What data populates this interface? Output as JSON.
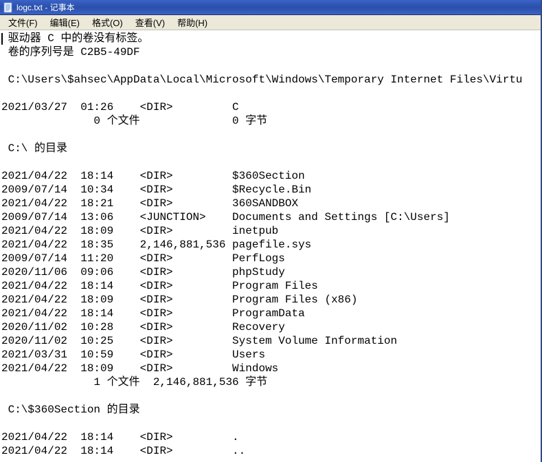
{
  "window": {
    "title": "logc.txt - 记事本"
  },
  "menu": {
    "file": "文件(F)",
    "edit": "编辑(E)",
    "format": "格式(O)",
    "view": "查看(V)",
    "help": "帮助(H)"
  },
  "text": {
    "drive_no_label": " 驱动器 C 中的卷没有标签。",
    "serial": " 卷的序列号是 C2B5-49DF",
    "path_line": " C:\\Users\\$ahsec\\AppData\\Local\\Microsoft\\Windows\\Temporary Internet Files\\Virtu",
    "virt_row": {
      "date": "2021/03/27",
      "time": "01:26",
      "type": "<DIR>",
      "name": "C"
    },
    "virt_summary": "              0 个文件              0 字节",
    "c_dir_header": " C:\\ 的目录",
    "rows": [
      {
        "date": "2021/04/22",
        "time": "18:14",
        "type": "<DIR>",
        "size": "",
        "name": "$360Section"
      },
      {
        "date": "2009/07/14",
        "time": "10:34",
        "type": "<DIR>",
        "size": "",
        "name": "$Recycle.Bin"
      },
      {
        "date": "2021/04/22",
        "time": "18:21",
        "type": "<DIR>",
        "size": "",
        "name": "360SANDBOX"
      },
      {
        "date": "2009/07/14",
        "time": "13:06",
        "type": "<JUNCTION>",
        "size": "",
        "name": "Documents and Settings [C:\\Users]"
      },
      {
        "date": "2021/04/22",
        "time": "18:09",
        "type": "<DIR>",
        "size": "",
        "name": "inetpub"
      },
      {
        "date": "2021/04/22",
        "time": "18:35",
        "type": "",
        "size": "2,146,881,536",
        "name": "pagefile.sys"
      },
      {
        "date": "2009/07/14",
        "time": "11:20",
        "type": "<DIR>",
        "size": "",
        "name": "PerfLogs"
      },
      {
        "date": "2020/11/06",
        "time": "09:06",
        "type": "<DIR>",
        "size": "",
        "name": "phpStudy"
      },
      {
        "date": "2021/04/22",
        "time": "18:14",
        "type": "<DIR>",
        "size": "",
        "name": "Program Files"
      },
      {
        "date": "2021/04/22",
        "time": "18:09",
        "type": "<DIR>",
        "size": "",
        "name": "Program Files (x86)"
      },
      {
        "date": "2021/04/22",
        "time": "18:14",
        "type": "<DIR>",
        "size": "",
        "name": "ProgramData"
      },
      {
        "date": "2020/11/02",
        "time": "10:28",
        "type": "<DIR>",
        "size": "",
        "name": "Recovery"
      },
      {
        "date": "2020/11/02",
        "time": "10:25",
        "type": "<DIR>",
        "size": "",
        "name": "System Volume Information"
      },
      {
        "date": "2021/03/31",
        "time": "10:59",
        "type": "<DIR>",
        "size": "",
        "name": "Users"
      },
      {
        "date": "2021/04/22",
        "time": "18:09",
        "type": "<DIR>",
        "size": "",
        "name": "Windows"
      }
    ],
    "c_summary": "              1 个文件  2,146,881,536 字节",
    "section_header": " C:\\$360Section 的目录",
    "section_rows": [
      {
        "date": "2021/04/22",
        "time": "18:14",
        "type": "<DIR>",
        "size": "",
        "name": "."
      },
      {
        "date": "2021/04/22",
        "time": "18:14",
        "type": "<DIR>",
        "size": "",
        "name": ".."
      }
    ]
  }
}
